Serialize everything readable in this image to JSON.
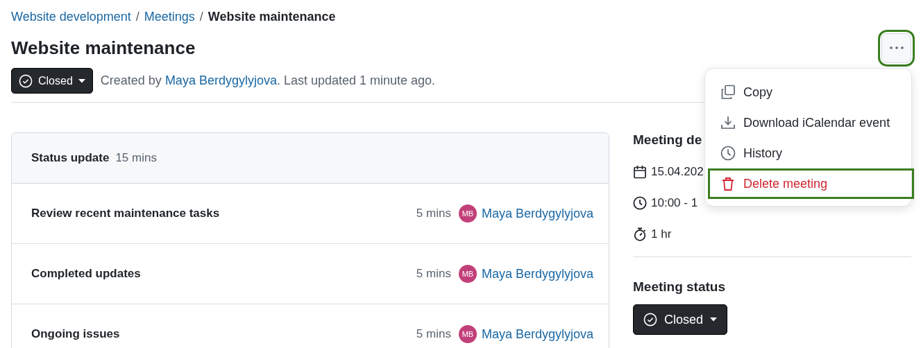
{
  "breadcrumb": [
    {
      "label": "Website development",
      "link": true,
      "separator": "/"
    },
    {
      "label": "Meetings",
      "link": true,
      "separator": "/"
    },
    {
      "label": "Website maintenance",
      "link": false
    }
  ],
  "title": "Website maintenance",
  "status_button": {
    "label": "Closed"
  },
  "meta": {
    "prefix": "Created by",
    "author": "Maya Berdygylyjova",
    "suffix": ". Last updated 1 minute ago."
  },
  "more_button": {
    "highlighted": true
  },
  "menu": [
    {
      "kind": "copy",
      "label": "Copy",
      "danger": false,
      "highlighted": false
    },
    {
      "kind": "download",
      "label": "Download iCalendar event",
      "danger": false,
      "highlighted": false
    },
    {
      "kind": "history",
      "label": "History",
      "danger": false,
      "highlighted": false
    },
    {
      "kind": "delete",
      "label": "Delete meeting",
      "danger": true,
      "highlighted": true
    }
  ],
  "section": {
    "title": "Status update",
    "duration": "15 mins"
  },
  "items": [
    {
      "title": "Review recent maintenance tasks",
      "duration": "5 mins",
      "initials": "MB",
      "presenter": "Maya Berdygylyjova"
    },
    {
      "title": "Completed updates",
      "duration": "5 mins",
      "initials": "MB",
      "presenter": "Maya Berdygylyjova"
    },
    {
      "title": "Ongoing issues",
      "duration": "5 mins",
      "initials": "MB",
      "presenter": "Maya Berdygylyjova"
    }
  ],
  "details": {
    "heading": "Meeting de",
    "rows": [
      {
        "kind": "date",
        "text": "15.04.202"
      },
      {
        "kind": "time",
        "text": "10:00 - 1"
      },
      {
        "kind": "duration",
        "text": "1 hr"
      }
    ]
  },
  "meeting_status": {
    "heading": "Meeting status",
    "button": "Closed"
  }
}
